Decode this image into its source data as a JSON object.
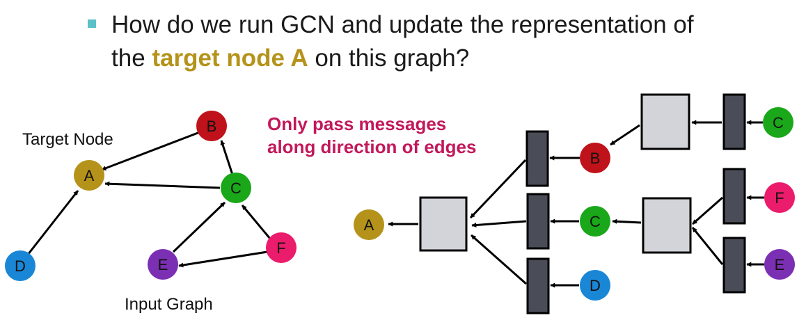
{
  "question": {
    "prefix": "How do we run GCN and update the representation of",
    "line2_start": "the ",
    "highlight": "target node A",
    "line2_end": " on this graph?"
  },
  "input_graph": {
    "caption": "Input Graph",
    "target_label": "Target Node",
    "nodes": [
      {
        "id": "A",
        "color": "#b5931a"
      },
      {
        "id": "B",
        "color": "#c0121b"
      },
      {
        "id": "C",
        "color": "#1aa71a"
      },
      {
        "id": "D",
        "color": "#1a86d6"
      },
      {
        "id": "E",
        "color": "#7b2fb3"
      },
      {
        "id": "F",
        "color": "#ea1c6b"
      }
    ],
    "edges": [
      [
        "B",
        "A"
      ],
      [
        "C",
        "A"
      ],
      [
        "D",
        "A"
      ],
      [
        "C",
        "B"
      ],
      [
        "E",
        "C"
      ],
      [
        "F",
        "C"
      ],
      [
        "F",
        "E"
      ]
    ]
  },
  "note": {
    "line1": "Only pass messages",
    "line2": "along direction of edges"
  },
  "computation_graph": {
    "nodes": [
      "A",
      "B",
      "C",
      "D",
      "C",
      "F",
      "E"
    ]
  },
  "colors": {
    "aggregator_box": "#d3d4da",
    "neural_net_box": "#4a4d57",
    "bullet": "#5bc0c7",
    "note": "#c2185b",
    "highlight": "#b5931a"
  }
}
